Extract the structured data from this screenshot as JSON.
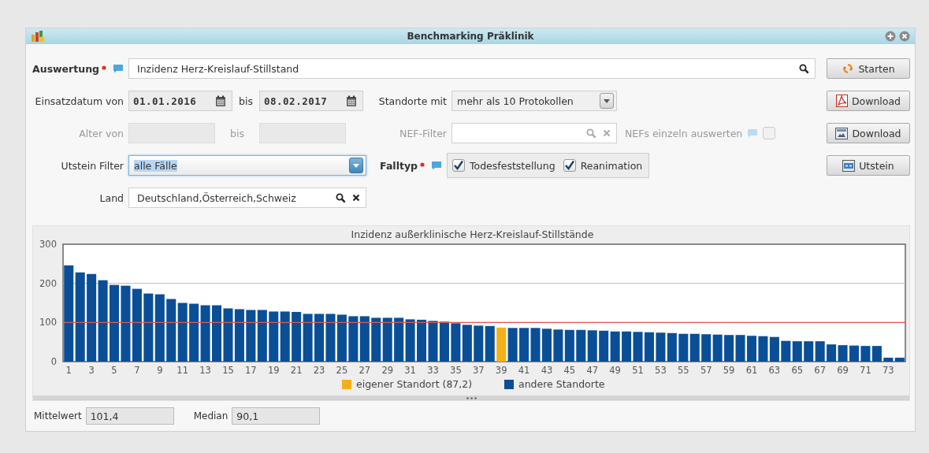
{
  "window": {
    "title": "Benchmarking Präklinik"
  },
  "form": {
    "auswertung": {
      "label": "Auswertung",
      "required": true,
      "value": "Inzidenz Herz-Kreislauf-Stillstand"
    },
    "einsatzdatum": {
      "label": "Einsatzdatum von",
      "from": "01.01.2016",
      "to_label": "bis",
      "to": "08.02.2017"
    },
    "standorte": {
      "label": "Standorte mit",
      "value": "mehr als 10 Protokollen"
    },
    "alter": {
      "label": "Alter von",
      "to_label": "bis",
      "disabled": true
    },
    "nef_filter": {
      "label": "NEF-Filter",
      "disabled": true
    },
    "nefs_einzeln": {
      "label": "NEFs einzeln auswerten",
      "checked": false,
      "disabled": true
    },
    "utstein_filter": {
      "label": "Utstein Filter",
      "value": "alle Fälle",
      "focused": true
    },
    "falltyp": {
      "label": "Falltyp",
      "required": true,
      "options": [
        {
          "label": "Todesfeststellung",
          "checked": true
        },
        {
          "label": "Reanimation",
          "checked": true
        }
      ]
    },
    "land": {
      "label": "Land",
      "value": "Deutschland,Österreich,Schweiz"
    }
  },
  "buttons": [
    {
      "kind": "start",
      "label": "Starten"
    },
    {
      "kind": "pdf",
      "label": "Download"
    },
    {
      "kind": "image",
      "label": "Download"
    },
    {
      "kind": "utstein",
      "label": "Utstein"
    }
  ],
  "chart": {
    "chart_data": {
      "type": "bar",
      "title": "Inzidenz außerklinische Herz-Kreislauf-Stillstände",
      "stacked": true,
      "x": [
        1,
        2,
        3,
        4,
        5,
        6,
        7,
        8,
        9,
        10,
        11,
        12,
        13,
        14,
        15,
        16,
        17,
        18,
        19,
        20,
        21,
        22,
        23,
        24,
        25,
        26,
        27,
        28,
        29,
        30,
        31,
        32,
        33,
        34,
        35,
        36,
        37,
        38,
        39,
        40,
        41,
        42,
        43,
        44,
        45,
        46,
        47,
        48,
        49,
        50,
        51,
        52,
        53,
        54,
        55,
        56,
        57,
        58,
        59,
        60,
        61,
        62,
        63,
        64,
        65,
        66,
        67,
        68,
        69,
        70,
        71,
        72,
        73,
        74
      ],
      "legend": "bottom",
      "xlim": [
        0.5,
        74.5
      ],
      "xticks": [
        1,
        3,
        5,
        7,
        9,
        11,
        13,
        15,
        17,
        19,
        21,
        23,
        25,
        27,
        29,
        31,
        33,
        35,
        37,
        39,
        41,
        43,
        45,
        47,
        49,
        51,
        53,
        55,
        57,
        59,
        61,
        63,
        65,
        67,
        69,
        71,
        73
      ],
      "ylim": [
        0,
        300
      ],
      "yticks": [
        0,
        100,
        200,
        300
      ],
      "series": [
        {
          "name": "eigener Standort (87,2)",
          "color": "#f5b019",
          "values": [
            null,
            null,
            null,
            null,
            null,
            null,
            null,
            null,
            null,
            null,
            null,
            null,
            null,
            null,
            null,
            null,
            null,
            null,
            null,
            null,
            null,
            null,
            null,
            null,
            null,
            null,
            null,
            null,
            null,
            null,
            null,
            null,
            null,
            null,
            null,
            null,
            null,
            null,
            87,
            null,
            null,
            null,
            null,
            null,
            null,
            null,
            null,
            null,
            null,
            null,
            null,
            null,
            null,
            null,
            null,
            null,
            null,
            null,
            null,
            null,
            null,
            null,
            null,
            null,
            null,
            null,
            null,
            null,
            null,
            null,
            null,
            null,
            null,
            null
          ]
        },
        {
          "name": "andere Standorte",
          "color": "#0a4f96",
          "values": [
            246,
            228,
            224,
            208,
            196,
            194,
            186,
            174,
            172,
            160,
            150,
            148,
            144,
            144,
            136,
            134,
            132,
            132,
            128,
            128,
            127,
            122,
            122,
            122,
            120,
            116,
            116,
            112,
            112,
            112,
            108,
            107,
            104,
            102,
            98,
            94,
            92,
            91,
            null,
            86,
            86,
            86,
            84,
            82,
            81,
            81,
            80,
            79,
            77,
            77,
            76,
            75,
            74,
            73,
            71,
            71,
            70,
            69,
            68,
            68,
            66,
            65,
            63,
            53,
            52,
            52,
            52,
            44,
            42,
            41,
            40,
            40,
            10,
            10
          ]
        }
      ],
      "ref_lines": [
        {
          "axis": "y",
          "value": 100,
          "color": "#e05a4f"
        }
      ]
    }
  },
  "stats": [
    {
      "label": "Mittelwert",
      "value": "101,4"
    },
    {
      "label": "Median",
      "value": "90,1"
    }
  ]
}
